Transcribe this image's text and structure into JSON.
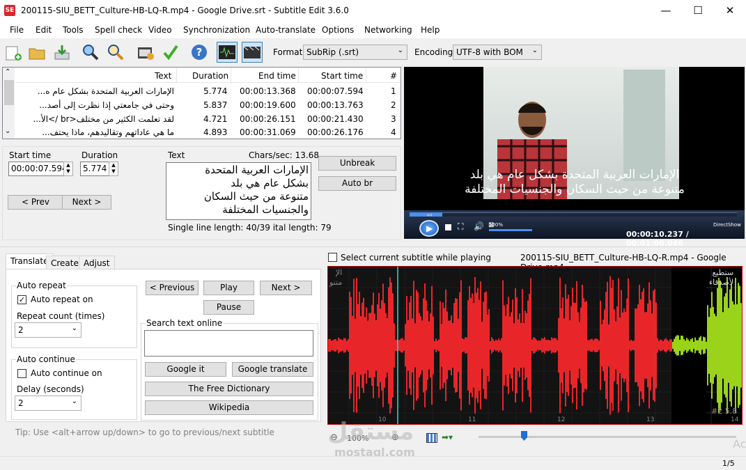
{
  "window": {
    "title": "200115-SIU_BETT_Culture-HB-LQ-R.mp4 - Google Drive.srt - Subtitle Edit 3.6.0",
    "app_icon": "SE",
    "minimize": "—",
    "maximize": "☐",
    "close": "✕"
  },
  "menu": [
    "File",
    "Edit",
    "Tools",
    "Spell check",
    "Video",
    "Synchronization",
    "Auto-translate",
    "Options",
    "Networking",
    "Help"
  ],
  "toolbar": {
    "format_label": "Format",
    "format_value": "SubRip (.srt)",
    "encoding_label": "Encoding",
    "encoding_value": "UTF-8 with BOM"
  },
  "grid": {
    "headers": {
      "text": "Text",
      "duration": "Duration",
      "end": "End time",
      "start": "Start time",
      "num": "#"
    },
    "rows": [
      {
        "text": "الإمارات العربية المتحدة بشكل عام ه...",
        "duration": "5.774",
        "end": "00:00:13.368",
        "start": "00:00:07.594",
        "num": "1"
      },
      {
        "text": "وحتى في جامعتي إذا نظرت إلى أصد...",
        "duration": "5.837",
        "end": "00:00:19.600",
        "start": "00:00:13.763",
        "num": "2"
      },
      {
        "text": "لقد تعلمت الكثير من مختلف<br />الأ...",
        "duration": "4.721",
        "end": "00:00:26.151",
        "start": "00:00:21.430",
        "num": "3"
      },
      {
        "text": "ما هي عاداتهم وتقاليدهم، ماذا يحتف...",
        "duration": "4.893",
        "end": "00:00:31.069",
        "start": "00:00:26.176",
        "num": "4"
      }
    ]
  },
  "editor": {
    "start_label": "Start time",
    "start_value": "00:00:07.594",
    "duration_label": "Duration",
    "duration_value": "5.774",
    "text_label": "Text",
    "chars_sec": "Chars/sec: 13.68",
    "text_lines": [
      "الإمارات العربية المتحدة",
      "بشكل عام هي بلد",
      "متنوعة من حيث السكان",
      "والجنسيات المختلفة"
    ],
    "unbreak": "Unbreak",
    "auto_br": "Auto br",
    "prev": "< Prev",
    "next": "Next >",
    "line_length": "Single line length: 40/39 ",
    "total_length": "ital length: 79"
  },
  "video": {
    "sub_line1": "الإمارات العربية المتحدة بشكل عام هي بلد",
    "sub_line2": "متنوعة من حيث السكان والجنسيات المختلفة",
    "volume": "100%",
    "volume_level": 1.0,
    "position_fraction": 0.1,
    "engine": "DirectShow",
    "time": "00:00:10.237 / 00:01:00.046"
  },
  "tabs": [
    "Translate",
    "Create",
    "Adjust"
  ],
  "translate": {
    "auto_repeat_group": "Auto repeat",
    "auto_repeat_on": "Auto repeat on",
    "repeat_count_label": "Repeat count (times)",
    "repeat_count": "2",
    "auto_continue_group": "Auto continue",
    "auto_continue_on": "Auto continue on",
    "delay_label": "Delay (seconds)",
    "delay": "2",
    "previous": "< Previous",
    "play": "Play",
    "next": "Next >",
    "pause": "Pause",
    "search_label": "Search text online",
    "google_it": "Google it",
    "google_translate": "Google translate",
    "free_dictionary": "The Free Dictionary",
    "wikipedia": "Wikipedia",
    "tip": "Tip: Use <alt+arrow up/down> to go to previous/next subtitle"
  },
  "waveform": {
    "select_while_playing": "Select current subtitle while playing",
    "file": "200115-SIU_BETT_Culture-HB-LQ-R.mp4 - Google Drive.mp4",
    "ticks": [
      "10",
      "11",
      "12",
      "13",
      "14"
    ],
    "left_text": [
      "الإ",
      "متنو"
    ],
    "right_text": [
      "ستطيع",
      "لأصدقاء"
    ],
    "subtitle_num": "#2  5.8",
    "zoom": "100%"
  },
  "watermark": {
    "arabic": "مستقل",
    "latin": "mostaql.com"
  },
  "status": {
    "page": "1/5",
    "activate_hint": "Ac"
  },
  "colors": {
    "wave_selected": "#e8262a",
    "wave_next": "#9bd31a",
    "accent": "#3c7fb1"
  }
}
